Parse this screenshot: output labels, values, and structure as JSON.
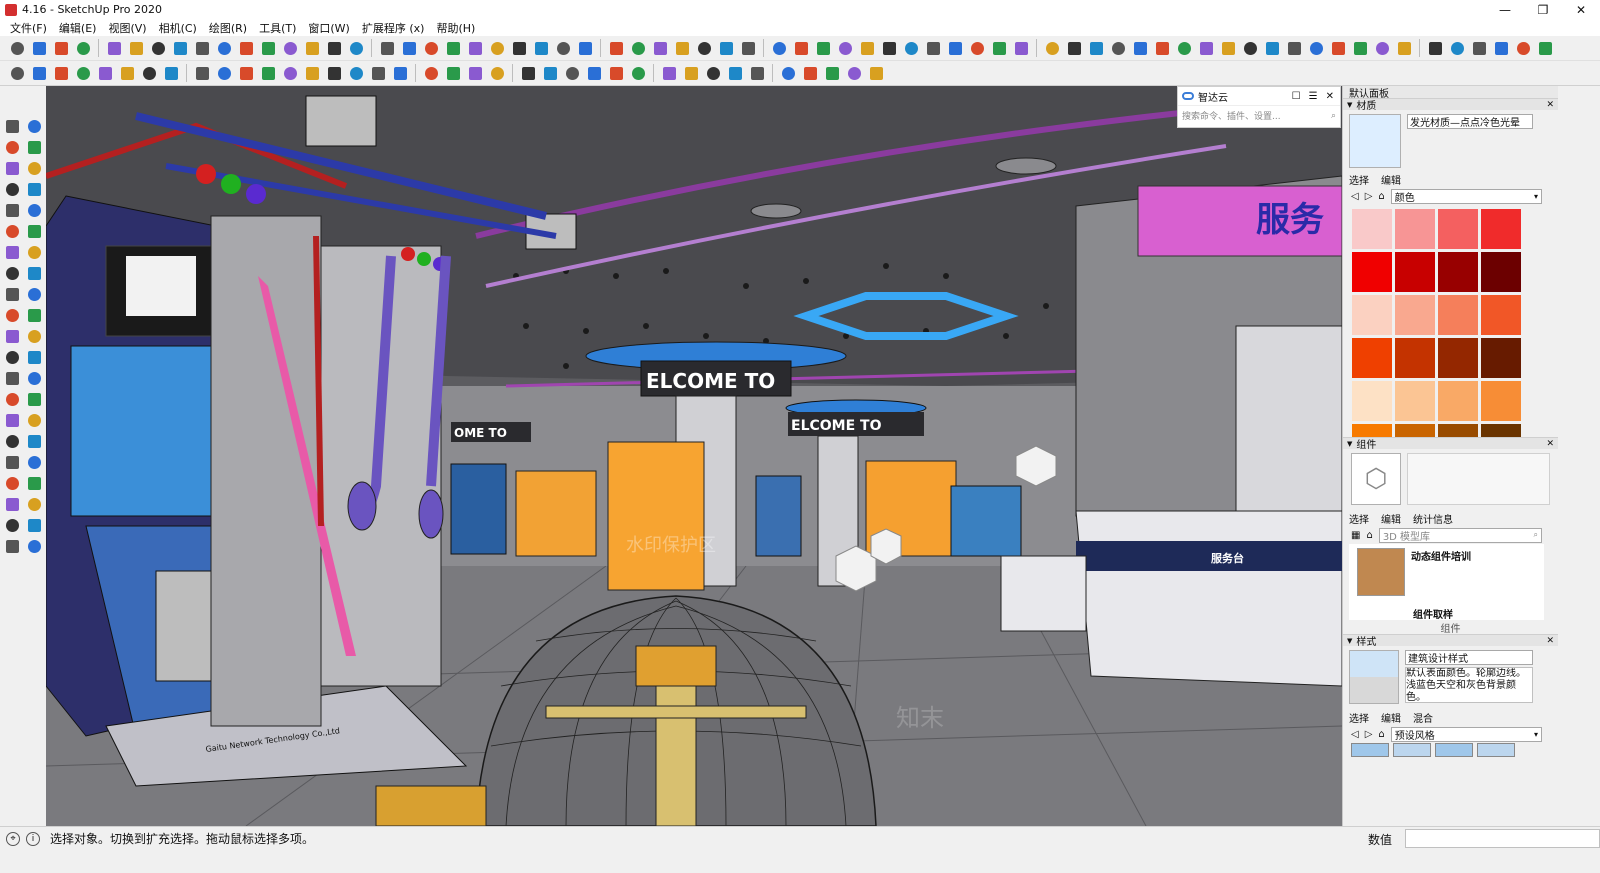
{
  "window": {
    "title": "4.16 - SketchUp Pro 2020",
    "controls": [
      "—",
      "❐",
      "✕"
    ]
  },
  "menu": [
    "文件(F)",
    "编辑(E)",
    "视图(V)",
    "相机(C)",
    "绘图(R)",
    "工具(T)",
    "窗口(W)",
    "扩展程序 (x)",
    "帮助(H)"
  ],
  "cloud_panel": {
    "title": "智达云",
    "controls": [
      "☐",
      "☰",
      "✕"
    ],
    "search_placeholder": "搜索命令、插件、设置..."
  },
  "tray": {
    "title": "默认面板",
    "materials": {
      "header": "材质",
      "name": "发光材质—点点冷色光晕",
      "tabs": [
        "选择",
        "编辑"
      ],
      "library": "颜色",
      "swatches": [
        "#f9c9c9",
        "#f79595",
        "#f46060",
        "#f02b2b",
        "#f00000",
        "#c80000",
        "#980000",
        "#6c0000",
        "#fbd1c1",
        "#f9a88f",
        "#f57f5b",
        "#f15727",
        "#ef4000",
        "#c43300",
        "#942700",
        "#671b00",
        "#fde1c5",
        "#fbc594",
        "#f9a966",
        "#f78d36",
        "#f77a00",
        "#c96400",
        "#984b00",
        "#6a3400"
      ]
    },
    "components": {
      "header": "组件",
      "tabs": [
        "选择",
        "编辑",
        "统计信息"
      ],
      "search_placeholder": "3D 模型库",
      "items": [
        {
          "label": "动态组件培训"
        },
        {
          "label": "组件取样"
        }
      ],
      "footer": "组件"
    },
    "styles": {
      "header": "样式",
      "name": "建筑设计样式",
      "description": "默认表面颜色。轮廓边线。浅蓝色天空和灰色背景颜色。",
      "tabs": [
        "选择",
        "编辑",
        "混合"
      ],
      "library": "预设风格"
    }
  },
  "status": {
    "message": "选择对象。切换到扩充选择。拖动鼠标选择多项。",
    "vcb_label": "数值"
  },
  "scene": {
    "welcome_sign": "ELCOME TO",
    "welcome_sign_2": "ELCOME TO",
    "welcome_sign_3": "OME TO",
    "service_sign": "服务",
    "service_desk": "服务台",
    "machine_text": "Gaitu Network Technology Co.,Ltd",
    "watermark": "水印保护区",
    "watermark_brand": "知末"
  }
}
